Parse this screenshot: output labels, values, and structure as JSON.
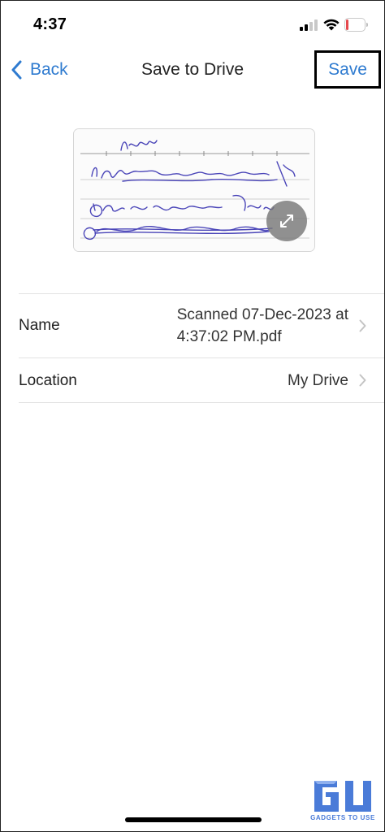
{
  "status_bar": {
    "time": "4:37",
    "battery_level": "12",
    "battery_fraction": 0.12,
    "icons": [
      "cellular-signal-icon",
      "wifi-icon",
      "battery-icon"
    ]
  },
  "nav": {
    "back_label": "Back",
    "title": "Save to Drive",
    "save_label": "Save",
    "accent_color": "#2f7bd0"
  },
  "preview": {
    "expand_icon": "expand-icon"
  },
  "fields": {
    "name": {
      "label": "Name",
      "value_line1": "Scanned 07-Dec-2023 at",
      "value_line2": "4:37:02 PM.pdf"
    },
    "location": {
      "label": "Location",
      "value": "My Drive"
    }
  },
  "watermark": {
    "text": "GADGETS TO USE"
  }
}
